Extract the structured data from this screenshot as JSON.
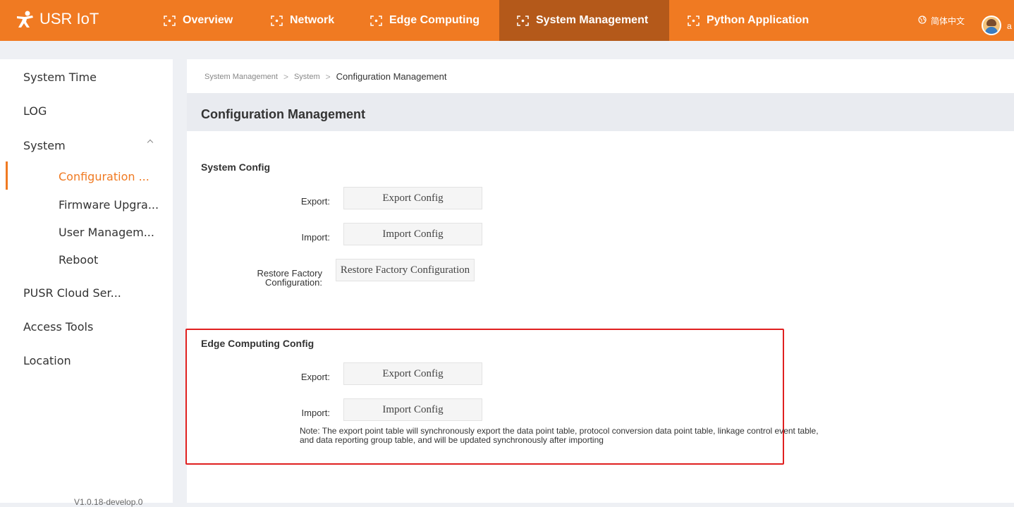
{
  "app": {
    "logo_text": "USR IoT"
  },
  "nav": [
    {
      "label": "Overview"
    },
    {
      "label": "Network"
    },
    {
      "label": "Edge Computing"
    },
    {
      "label": "System Management",
      "active": true
    },
    {
      "label": "Python Application"
    }
  ],
  "header": {
    "language": "简体中文",
    "user_initial": "a"
  },
  "sidebar": {
    "items": [
      {
        "label": "System Time"
      },
      {
        "label": "LOG"
      },
      {
        "label": "System"
      },
      {
        "label": "PUSR Cloud Ser..."
      },
      {
        "label": "Access Tools"
      },
      {
        "label": "Location"
      }
    ],
    "sub_items": [
      {
        "label": "Configuration ...",
        "active": true
      },
      {
        "label": "Firmware Upgra..."
      },
      {
        "label": "User Managem..."
      },
      {
        "label": "Reboot"
      }
    ],
    "version": "V1.0.18-develop.0"
  },
  "breadcrumb": [
    "System Management",
    "System",
    "Configuration Management"
  ],
  "page_title": "Configuration Management",
  "system_config": {
    "title": "System Config",
    "export_label": "Export:",
    "export_button": "Export Config",
    "import_label": "Import:",
    "import_button": "Import Config",
    "restore_label": "Restore Factory Configuration:",
    "restore_button": "Restore Factory Configuration"
  },
  "edge_config": {
    "title": "Edge Computing Config",
    "export_label": "Export:",
    "export_button": "Export Config",
    "import_label": "Import:",
    "import_button": "Import Config",
    "note": "Note: The export point table will synchronously export the data point table, protocol conversion data point table, linkage control event table, and data reporting group table, and will be updated synchronously after importing"
  },
  "colors": {
    "accent": "#f07a22",
    "active_nav": "#b4591a",
    "highlight": "#e02020"
  }
}
